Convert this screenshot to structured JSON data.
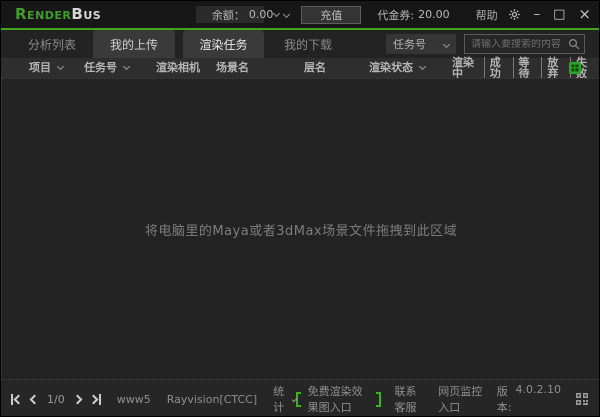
{
  "title_bar": {
    "logo_render": "Render",
    "logo_bus": "Bus",
    "balance_label": "余额：",
    "balance_value": "0.00",
    "recharge_button": "充值",
    "voucher_label": "代金券:",
    "voucher_value": "20.00",
    "help": "帮助"
  },
  "tab_bar": {
    "tabs": [
      {
        "label": "分析列表"
      },
      {
        "label": "我的上传"
      },
      {
        "label": "渲染任务"
      },
      {
        "label": "我的下载"
      }
    ],
    "active_tab": "渲染任务",
    "search_field_selector": "任务号",
    "search_placeholder": "请输入要搜索的内容",
    "search_value": ""
  },
  "table_header": {
    "columns": [
      "项目",
      "任务号",
      "渲染相机",
      "场景名",
      "层名",
      "渲染状态"
    ],
    "status_filters": [
      "渲染中",
      "成功",
      "等待",
      "放弃",
      "失败"
    ]
  },
  "dropzone": {
    "hint": "将电脑里的Maya或者3dMax场景文件拖拽到此区域"
  },
  "footer": {
    "page_indicator": "1/0",
    "server_node": "www5",
    "client_line": "Rayvision[CTCC]",
    "stats_label": "统计",
    "free_render_entry": "免费渲染效果图入口",
    "contact_support": "联系客服",
    "web_monitor_entry": "网页监控入口",
    "version_label": "版本:",
    "version_value": "4.0.2.10"
  },
  "colors": {
    "accent_green": "#3fa51c",
    "logo_green": "#3f9e2b",
    "excel_icon_green": "#2ea32a",
    "titlebar_bg": "#171717",
    "panel_bg": "#232323",
    "header_bg": "#2e2e2e"
  },
  "icons": {
    "search": "magnifier",
    "settings": "gear",
    "minimize": "minus",
    "maximize": "square",
    "close": "x",
    "export_report": "green-excel-grid",
    "qr_code": "qr-grid",
    "dropdowns": "chevron-down",
    "pagination": [
      "first-page",
      "prev-page",
      "next-page",
      "last-page"
    ]
  }
}
